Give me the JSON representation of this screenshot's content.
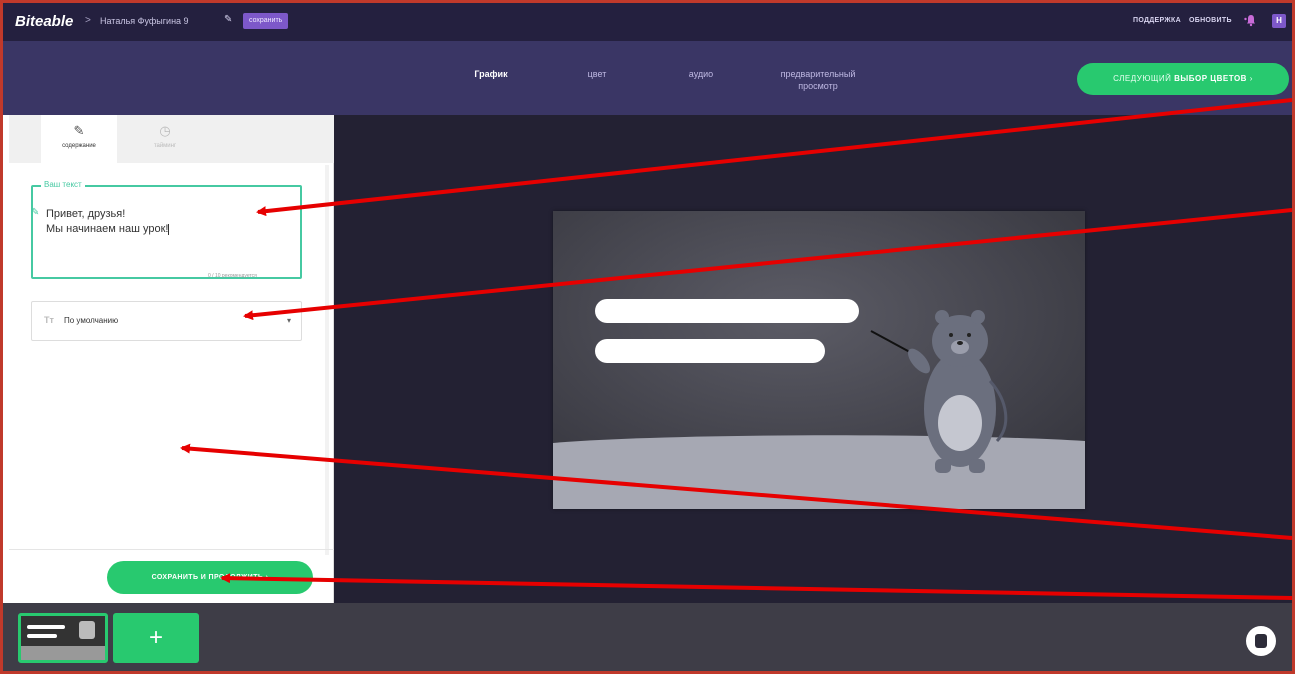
{
  "app": {
    "brand": "Biteable",
    "crumb_separator": ">",
    "project_name": "Наталья Фуфыгина 9",
    "save_chip_label": "сохранить"
  },
  "header": {
    "support_label": "ПОДДЕРЖКА",
    "update_label": "ОБНОВИТЬ",
    "avatar_initial": "Н"
  },
  "nav": {
    "steps": [
      {
        "label": "График",
        "active": true
      },
      {
        "label": "цвет",
        "active": false
      },
      {
        "label": "аудио",
        "active": false
      },
      {
        "label": "предварительный просмотр",
        "active": false
      }
    ],
    "next_button_prefix": "СЛЕДУЮЩИЙ",
    "next_button_bold": "ВЫБОР ЦВЕТОВ",
    "next_button_arrow": "›"
  },
  "panel": {
    "tabs": [
      {
        "label": "содержание",
        "icon": "pencil-icon",
        "active": true
      },
      {
        "label": "тайминг",
        "icon": "stopwatch-icon",
        "active": false
      }
    ],
    "text_field": {
      "label": "Ваш текст",
      "value_line1": "Привет, друзья!",
      "value_line2": "Мы начинаем наш урок!",
      "counter": "0 / 10 рекомендуется"
    },
    "font_select": {
      "icon": "Tт",
      "value": "По умолчанию"
    },
    "save_button": "СОХРАНИТЬ И ПРОДОЛЖИТЬ ›"
  },
  "bottom": {
    "add_label": "+"
  },
  "colors": {
    "topbar": "#24203f",
    "navbar": "#3a3665",
    "accent_green": "#28c96f",
    "textbox_border": "#46c9a2",
    "canvas_bg": "#232133",
    "annotation_arrow": "#e60000"
  }
}
